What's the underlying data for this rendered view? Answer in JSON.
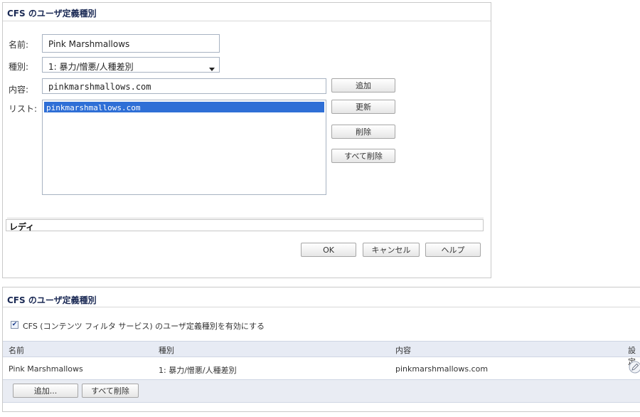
{
  "dialog": {
    "title": "CFS のユーザ定義種別",
    "name_label": "名前:",
    "name_value": "Pink Marshmallows",
    "category_label": "種別:",
    "category_value": "1: 暴力/憎悪/人種差別",
    "content_label": "内容:",
    "content_value": "pinkmarshmallows.com",
    "list_label": "リスト:",
    "list_items": [
      "pinkmarshmallows.com"
    ],
    "buttons": {
      "add": "追加",
      "update": "更新",
      "delete": "削除",
      "delete_all": "すべて削除",
      "ok": "OK",
      "cancel": "キャンセル",
      "help": "ヘルプ"
    },
    "status": "レディ"
  },
  "section": {
    "title": "CFS のユーザ定義種別",
    "enable_checked": true,
    "enable_label": "CFS (コンテンツ フィルタ サービス) のユーザ定義種別を有効にする",
    "columns": [
      "名前",
      "種別",
      "内容",
      "設定"
    ],
    "rows": [
      {
        "name": "Pink Marshmallows",
        "category": "1: 暴力/憎悪/人種差別",
        "content": "pinkmarshmallows.com"
      }
    ],
    "buttons": {
      "add": "追加...",
      "delete_all": "すべて削除"
    }
  },
  "icons": {
    "dropdown": "chevron-down-icon",
    "configure": "edit-pencil-icon",
    "checkbox": "check-icon"
  }
}
